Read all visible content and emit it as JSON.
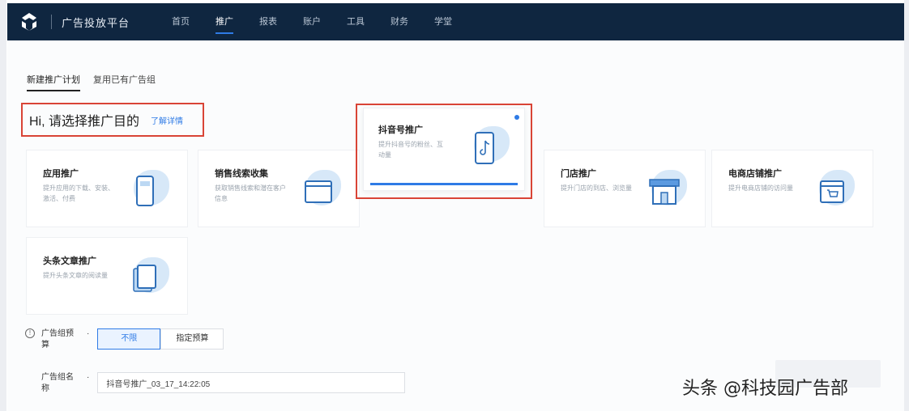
{
  "topbar": {
    "brand": "广告投放平台",
    "nav": [
      "首页",
      "推广",
      "报表",
      "账户",
      "工具",
      "财务",
      "学堂"
    ],
    "active_index": 1,
    "bg_color": "#0f2640",
    "accent_color": "#2f7be6"
  },
  "subtabs": [
    "新建推广计划",
    "复用已有广告组"
  ],
  "heading": {
    "title": "Hi, 请选择推广目的",
    "link": "了解详情"
  },
  "cards": [
    {
      "title": "应用推广",
      "desc": "提升应用的下载、安装、激活、付费",
      "icon": "phone-app-icon"
    },
    {
      "title": "销售线索收集",
      "desc": "获取销售线索和潜在客户信息",
      "icon": "browser-window-icon"
    },
    {
      "title": "抖音号推广",
      "desc": "提升抖音号的粉丝、互动量",
      "icon": "douyin-phone-icon",
      "selected": true
    },
    {
      "title": "门店推广",
      "desc": "提升门店的到店、浏览量",
      "icon": "storefront-icon"
    },
    {
      "title": "电商店铺推广",
      "desc": "提升电商店铺的访问量",
      "icon": "shopping-cart-icon"
    },
    {
      "title": "头条文章推广",
      "desc": "提升头条文章的阅读量",
      "icon": "article-card-icon"
    }
  ],
  "form": {
    "budget_label": "广告组预算",
    "budget_options": [
      "不限",
      "指定预算"
    ],
    "budget_selected": 0,
    "name_label": "广告组名称",
    "name_value": "抖音号推广_03_17_14:22:05"
  },
  "watermark": "头条 @科技园广告部"
}
